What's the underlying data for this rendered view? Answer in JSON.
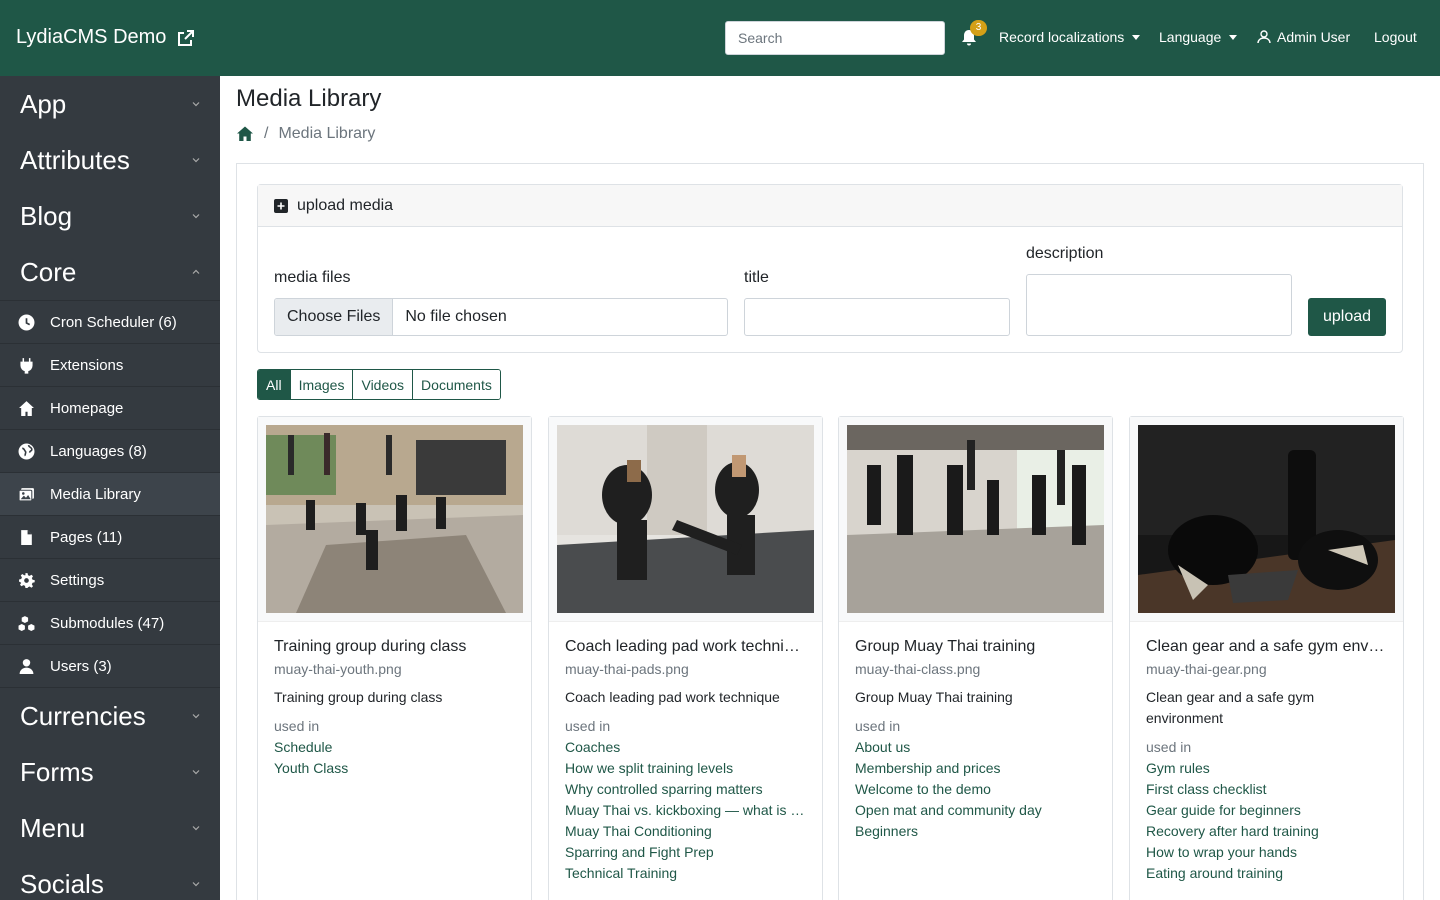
{
  "header": {
    "brand": "LydiaCMS Demo",
    "search_placeholder": "Search",
    "notification_count": "3",
    "record_localizations": "Record localizations",
    "language": "Language",
    "user": "Admin User",
    "logout": "Logout"
  },
  "sidebar": {
    "sections_top": [
      {
        "label": "App",
        "state": "collapsed"
      },
      {
        "label": "Attributes",
        "state": "collapsed"
      },
      {
        "label": "Blog",
        "state": "collapsed"
      },
      {
        "label": "Core",
        "state": "expanded"
      }
    ],
    "core_items": [
      {
        "label": "Cron Scheduler (6)",
        "icon": "clock-icon"
      },
      {
        "label": "Extensions",
        "icon": "plug-icon"
      },
      {
        "label": "Homepage",
        "icon": "home-icon"
      },
      {
        "label": "Languages (8)",
        "icon": "globe-icon"
      },
      {
        "label": "Media Library",
        "icon": "images-icon",
        "active": true
      },
      {
        "label": "Pages (11)",
        "icon": "file-icon"
      },
      {
        "label": "Settings",
        "icon": "gear-icon"
      },
      {
        "label": "Submodules (47)",
        "icon": "cubes-icon"
      },
      {
        "label": "Users (3)",
        "icon": "user-icon"
      }
    ],
    "sections_bottom": [
      {
        "label": "Currencies",
        "state": "collapsed"
      },
      {
        "label": "Forms",
        "state": "collapsed"
      },
      {
        "label": "Menu",
        "state": "collapsed"
      },
      {
        "label": "Socials",
        "state": "collapsed"
      }
    ]
  },
  "main": {
    "title": "Media Library",
    "breadcrumb": {
      "home_icon": "home-icon",
      "current": "Media Library"
    },
    "upload": {
      "header": "upload media",
      "media_files_label": "media files",
      "choose_files": "Choose Files",
      "no_file": "No file chosen",
      "title_label": "title",
      "description_label": "description",
      "upload_button": "upload"
    },
    "filters": [
      {
        "label": "All",
        "active": true
      },
      {
        "label": "Images"
      },
      {
        "label": "Videos"
      },
      {
        "label": "Documents"
      }
    ],
    "used_in_label": "used in",
    "media": [
      {
        "title": "Training group during class",
        "file": "muay-thai-youth.png",
        "description": "Training group during class",
        "used_in": [
          "Schedule",
          "Youth Class"
        ]
      },
      {
        "title": "Coach leading pad work technique",
        "file": "muay-thai-pads.png",
        "description": "Coach leading pad work technique",
        "used_in": [
          "Coaches",
          "How we split training levels",
          "Why controlled sparring matters",
          "Muay Thai vs. kickboxing — what is the difference",
          "Muay Thai Conditioning",
          "Sparring and Fight Prep",
          "Technical Training"
        ]
      },
      {
        "title": "Group Muay Thai training",
        "file": "muay-thai-class.png",
        "description": "Group Muay Thai training",
        "used_in": [
          "About us",
          "Membership and prices",
          "Welcome to the demo",
          "Open mat and community day",
          "Beginners"
        ]
      },
      {
        "title": "Clean gear and a safe gym environment",
        "file": "muay-thai-gear.png",
        "description": "Clean gear and a safe gym environment",
        "used_in": [
          "Gym rules",
          "First class checklist",
          "Gear guide for beginners",
          "Recovery after hard training",
          "How to wrap your hands",
          "Eating around training"
        ]
      }
    ]
  }
}
